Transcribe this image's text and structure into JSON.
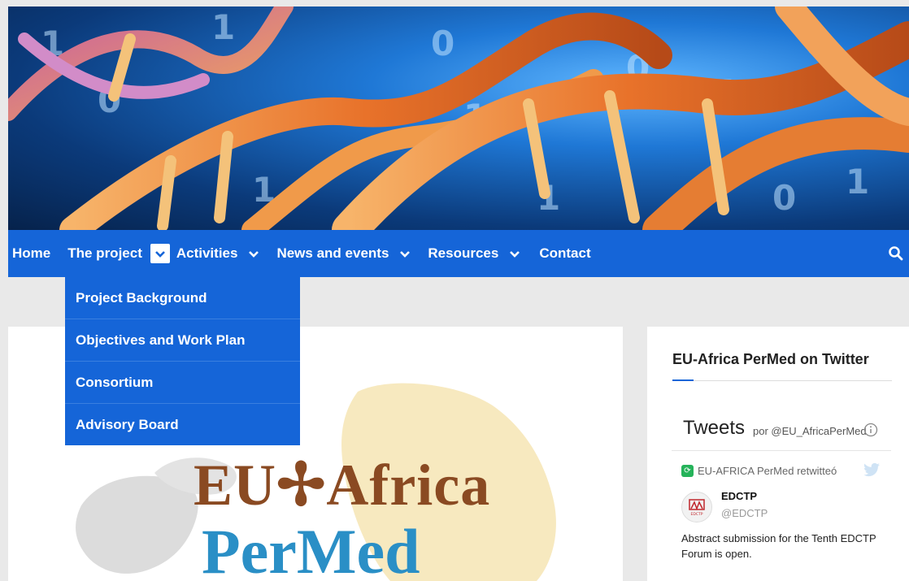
{
  "nav": {
    "items": [
      {
        "label": "Home"
      },
      {
        "label": "The project"
      },
      {
        "label": "Activities"
      },
      {
        "label": "News and events"
      },
      {
        "label": "Resources"
      },
      {
        "label": "Contact"
      }
    ],
    "search_icon": "search-icon"
  },
  "dropdown": {
    "items": [
      {
        "label": "Project Background"
      },
      {
        "label": "Objectives and Work Plan"
      },
      {
        "label": "Consortium"
      },
      {
        "label": "Advisory Board"
      }
    ]
  },
  "logo": {
    "line1": "EU✢Africa",
    "line2": "PerMed"
  },
  "sidebar": {
    "title": "EU-Africa PerMed on Twitter",
    "tweets_heading": "Tweets",
    "tweets_by": "por @EU_AfricaPerMed",
    "retweet_text": "EU-AFRICA PerMed retwitteó",
    "account_name": "EDCTP",
    "account_handle": "@EDCTP",
    "tweet_text": "Abstract submission for the Tenth EDCTP Forum is open."
  },
  "colors": {
    "nav_blue": "#1565d8",
    "logo_brown": "#8a4a22",
    "logo_blue": "#2a8fc6"
  }
}
